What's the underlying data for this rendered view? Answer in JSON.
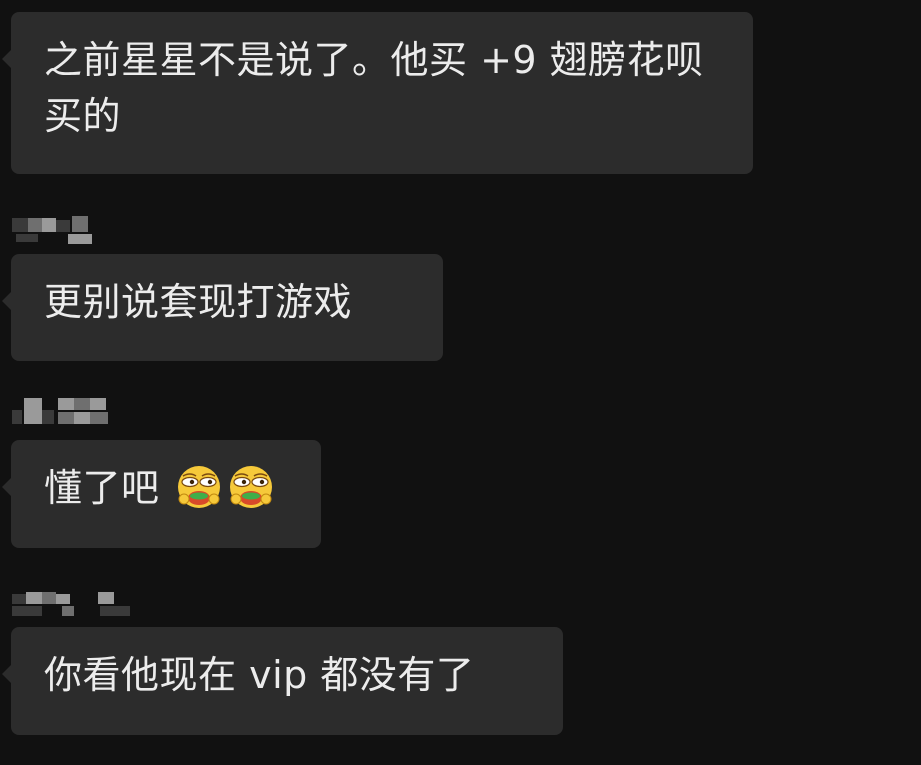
{
  "conversation": {
    "messages": [
      {
        "text": "之前星星不是说了。他买 +9 翅膀花呗买的"
      },
      {
        "text": "更别说套现打游戏"
      },
      {
        "text": "懂了吧",
        "emoji": [
          "smirk-face-emoji",
          "smirk-face-emoji"
        ]
      },
      {
        "text": "你看他现在 vip 都没有了"
      }
    ]
  },
  "colors": {
    "background": "#111111",
    "bubble": "#2c2c2c",
    "text": "#ececec"
  }
}
